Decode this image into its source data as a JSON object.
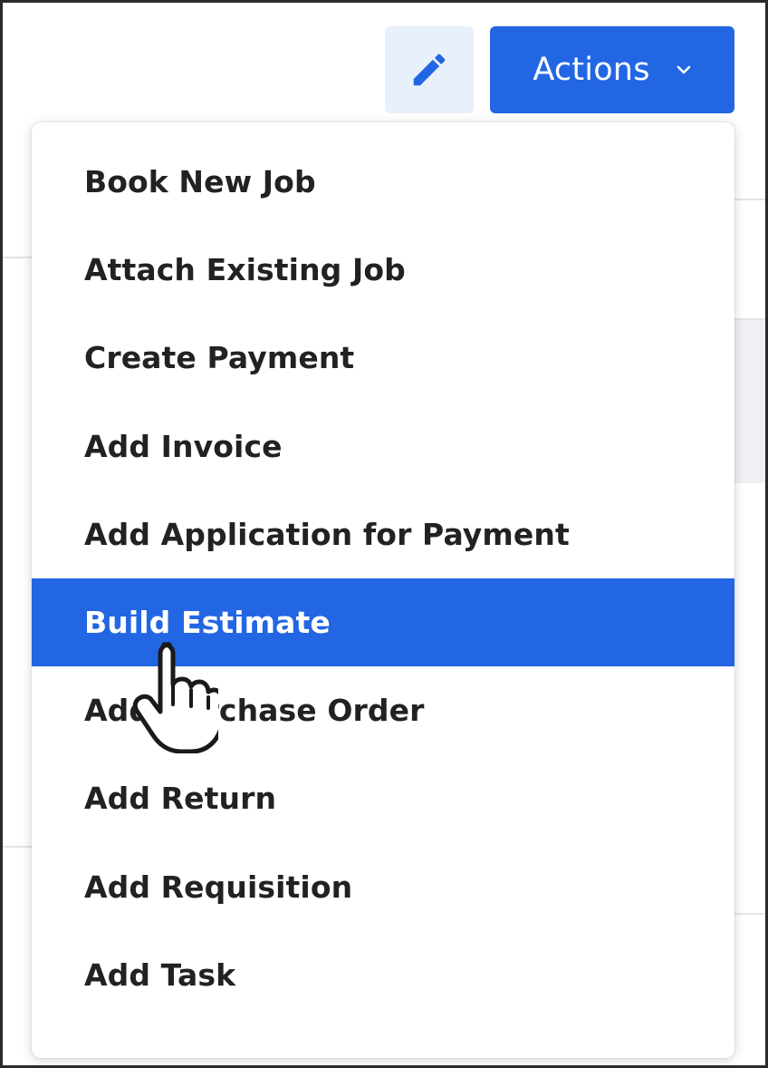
{
  "toolbar": {
    "edit_icon": "pencil-icon",
    "actions_label": "Actions",
    "actions_chevron_icon": "chevron-down-icon",
    "accent_color": "#2266e3",
    "edit_bg_color": "#e8f0fb"
  },
  "menu": {
    "items": [
      {
        "label": "Book New Job"
      },
      {
        "label": "Attach Existing Job"
      },
      {
        "label": "Create Payment"
      },
      {
        "label": "Add Invoice"
      },
      {
        "label": "Add Application for Payment"
      },
      {
        "label": "Build Estimate",
        "highlighted": true
      },
      {
        "label": "Add Purchase Order"
      },
      {
        "label": "Add Return"
      },
      {
        "label": "Add Requisition"
      },
      {
        "label": "Add Task"
      }
    ]
  },
  "pointer": {
    "icon": "hand-pointer-icon"
  }
}
